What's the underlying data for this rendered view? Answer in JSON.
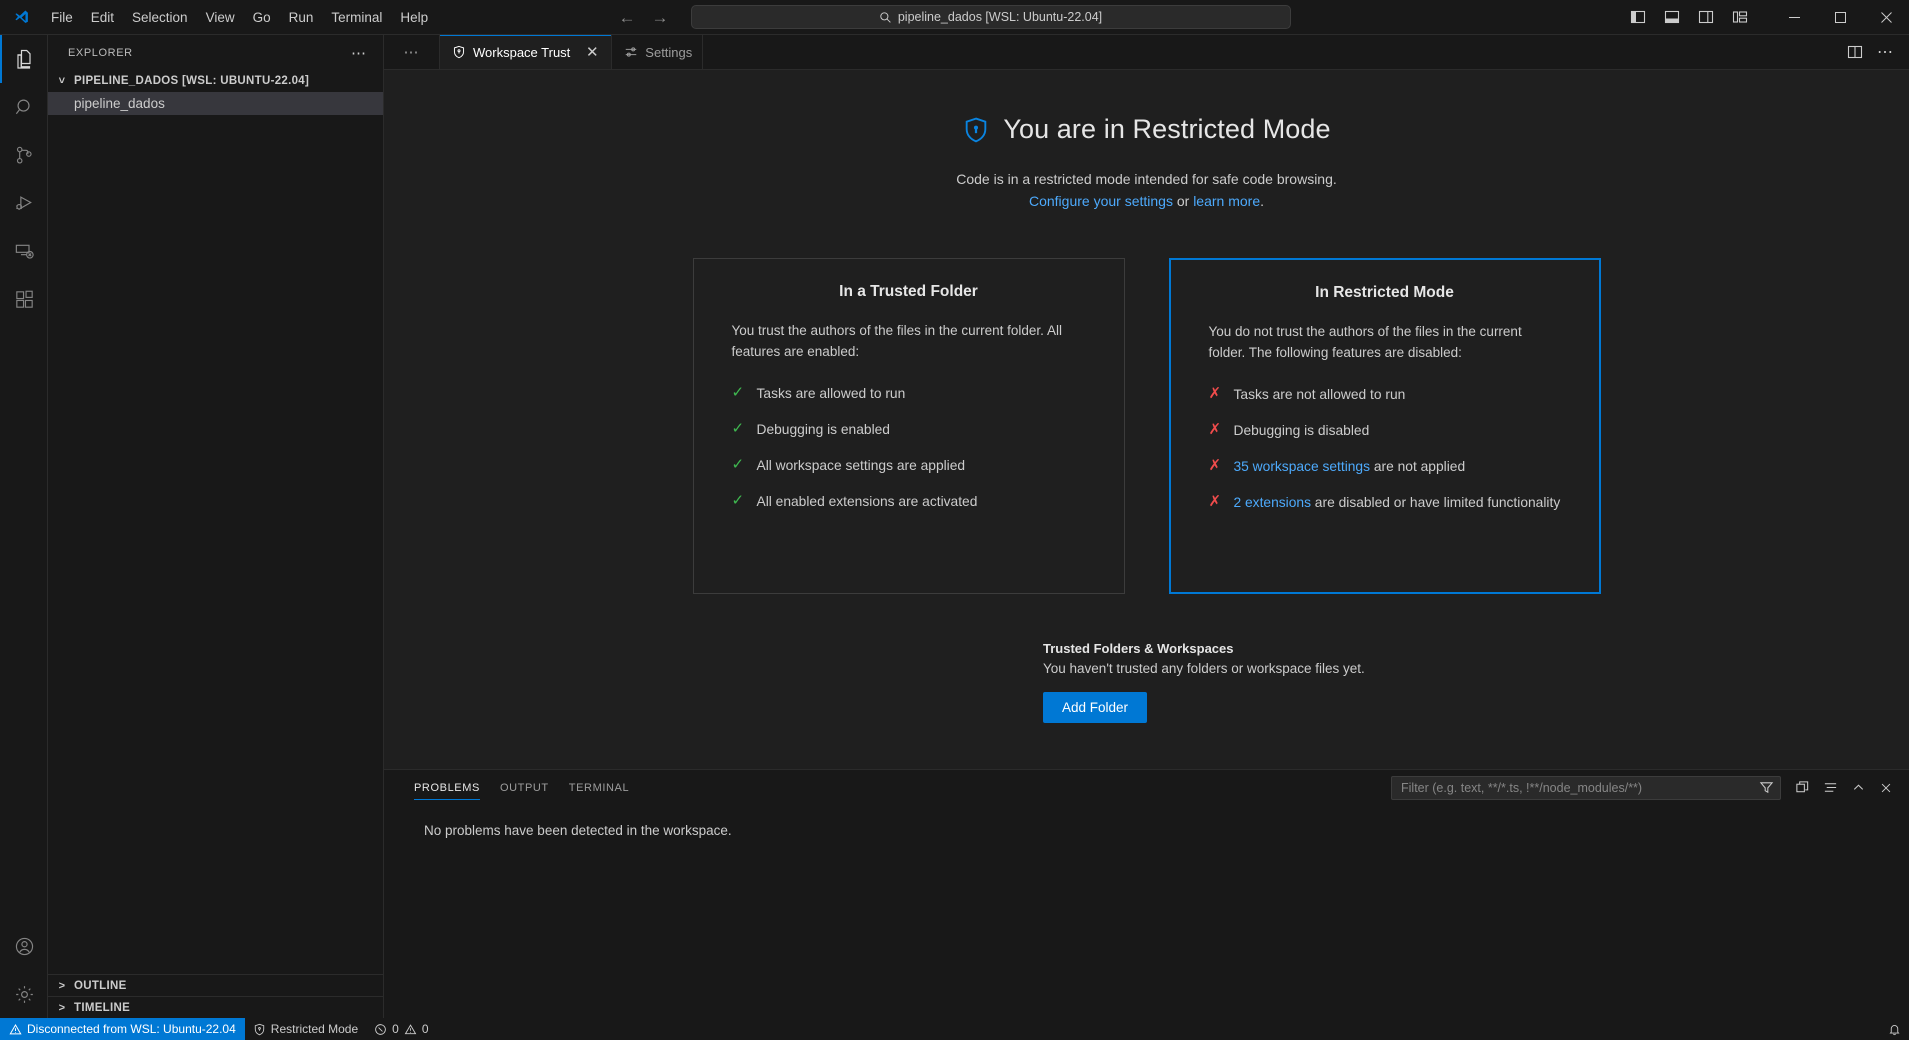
{
  "titlebar": {
    "logo_icon": "vscode-logo-icon",
    "menus": [
      "File",
      "Edit",
      "Selection",
      "View",
      "Go",
      "Run",
      "Terminal",
      "Help"
    ],
    "nav": {
      "back_icon": "arrow-left-icon",
      "forward_icon": "arrow-right-icon"
    },
    "command_center": {
      "search_icon": "search-icon",
      "text": "pipeline_dados [WSL: Ubuntu-22.04]"
    },
    "layout_buttons": [
      {
        "name": "toggle-primary-sidebar",
        "icon": "layout-sidebar-left-icon"
      },
      {
        "name": "toggle-panel",
        "icon": "layout-panel-icon"
      },
      {
        "name": "toggle-secondary-sidebar",
        "icon": "layout-sidebar-right-icon"
      },
      {
        "name": "customize-layout",
        "icon": "layout-customize-icon"
      }
    ],
    "window_buttons": [
      {
        "name": "minimize",
        "glyph": "—"
      },
      {
        "name": "maximize",
        "glyph": "□"
      },
      {
        "name": "close",
        "glyph": "✕"
      }
    ]
  },
  "activitybar": {
    "items": [
      {
        "name": "explorer",
        "icon": "files-icon",
        "active": true
      },
      {
        "name": "search",
        "icon": "search-icon",
        "active": false
      },
      {
        "name": "source-control",
        "icon": "source-control-icon",
        "active": false
      },
      {
        "name": "run-and-debug",
        "icon": "run-debug-icon",
        "active": false
      },
      {
        "name": "remote-explorer",
        "icon": "remote-explorer-icon",
        "active": false
      },
      {
        "name": "extensions",
        "icon": "extensions-icon",
        "active": false
      }
    ],
    "bottom": [
      {
        "name": "accounts",
        "icon": "account-icon"
      },
      {
        "name": "manage",
        "icon": "gear-icon"
      }
    ]
  },
  "sidebar": {
    "title": "EXPLORER",
    "more_actions_icon": "ellipsis-icon",
    "folder_header": "PIPELINE_DADOS [WSL: UBUNTU-22.04]",
    "folder_chevron": "chevron-down-icon",
    "files": [
      {
        "label": "pipeline_dados",
        "selected": true
      }
    ],
    "bottom_sections": [
      {
        "label": "OUTLINE",
        "chevron": "chevron-right-icon"
      },
      {
        "label": "TIMELINE",
        "chevron": "chevron-right-icon"
      }
    ]
  },
  "tabbar": {
    "pre_actions_icon": "ellipsis-icon",
    "tabs": [
      {
        "label": "Workspace Trust",
        "icon": "shield-icon",
        "active": true,
        "close_glyph": "✕"
      },
      {
        "label": "Settings",
        "icon": "settings-sliders-icon",
        "active": false,
        "close_glyph": ""
      }
    ],
    "actions": [
      {
        "name": "split-editor",
        "icon": "split-editor-icon"
      },
      {
        "name": "more-editor-actions",
        "icon": "ellipsis-icon"
      }
    ]
  },
  "workspace_trust": {
    "shield_icon": "shield-lock-icon",
    "heading": "You are in Restricted Mode",
    "subtitle": "Code is in a restricted mode intended for safe code browsing.",
    "link_configure": "Configure your settings",
    "link_or": " or ",
    "link_learn_more": "learn more",
    "link_period": ".",
    "cards": [
      {
        "id": "trusted",
        "title": "In a Trusted Folder",
        "description": "You trust the authors of the files in the current folder. All features are enabled:",
        "items": [
          {
            "mark": "check-icon",
            "text": "Tasks are allowed to run"
          },
          {
            "mark": "check-icon",
            "text": "Debugging is enabled"
          },
          {
            "mark": "check-icon",
            "text": "All workspace settings are applied"
          },
          {
            "mark": "check-icon",
            "text": "All enabled extensions are activated"
          }
        ]
      },
      {
        "id": "restricted",
        "title": "In Restricted Mode",
        "description": "You do not trust the authors of the files in the current folder. The following features are disabled:",
        "items": [
          {
            "mark": "x-icon",
            "text": "Tasks are not allowed to run"
          },
          {
            "mark": "x-icon",
            "text": "Debugging is disabled"
          },
          {
            "mark": "x-icon",
            "link": "35 workspace settings",
            "text": " are not applied"
          },
          {
            "mark": "x-icon",
            "link": "2 extensions",
            "text": " are disabled or have limited functionality"
          }
        ]
      }
    ],
    "trusted_section": {
      "title": "Trusted Folders & Workspaces",
      "empty_text": "You haven't trusted any folders or workspace files yet.",
      "button_label": "Add Folder"
    },
    "accent_color": "#0078d4",
    "check_color": "#3fb950",
    "x_color": "#f14c4c"
  },
  "panel": {
    "tabs": [
      {
        "label": "PROBLEMS",
        "active": true
      },
      {
        "label": "OUTPUT",
        "active": false
      },
      {
        "label": "TERMINAL",
        "active": false
      }
    ],
    "filter_placeholder": "Filter (e.g. text, **/*.ts, !**/node_modules/**)",
    "filter_value": "",
    "filter_icon": "funnel-icon",
    "actions": [
      {
        "name": "clear-filters",
        "icon": "funnel-icon"
      },
      {
        "name": "view-as-table",
        "icon": "copy-icon"
      },
      {
        "name": "collapse-all",
        "icon": "list-icon"
      },
      {
        "name": "maximize-panel",
        "icon": "chevron-up-icon"
      },
      {
        "name": "close-panel",
        "icon": "close-icon"
      }
    ],
    "message": "No problems have been detected in the workspace."
  },
  "statusbar": {
    "remote": {
      "icon": "warning-icon",
      "label": "Disconnected from WSL: Ubuntu-22.04"
    },
    "trust": {
      "icon": "shield-icon",
      "label": "Restricted Mode"
    },
    "problems": {
      "error_icon": "error-circle-icon",
      "errors": "0",
      "warning_icon": "warning-triangle-icon",
      "warnings": "0"
    },
    "notifications_icon": "bell-icon",
    "remote_bg": "#0078d4"
  }
}
